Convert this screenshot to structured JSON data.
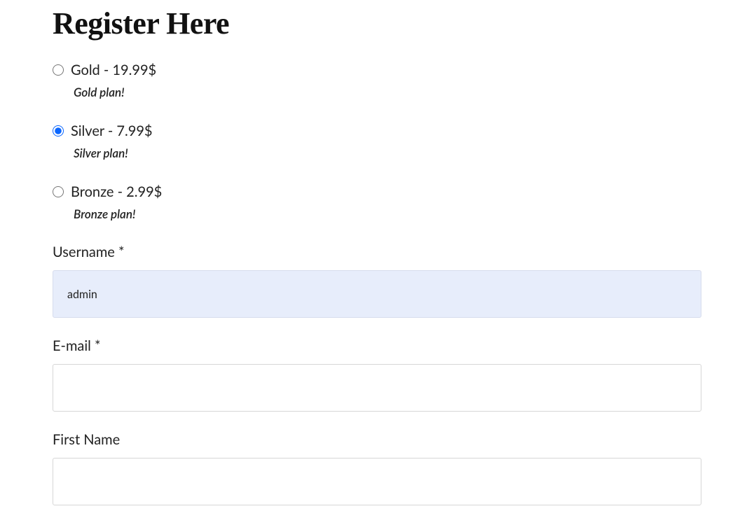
{
  "page": {
    "title": "Register Here"
  },
  "plans": {
    "gold": {
      "label": "Gold - 19.99$",
      "desc": "Gold plan!",
      "checked": false
    },
    "silver": {
      "label": "Silver - 7.99$",
      "desc": "Silver plan!",
      "checked": true
    },
    "bronze": {
      "label": "Bronze - 2.99$",
      "desc": "Bronze plan!",
      "checked": false
    }
  },
  "fields": {
    "username": {
      "label": "Username *",
      "value": "admin"
    },
    "email": {
      "label": "E-mail *",
      "value": ""
    },
    "firstname": {
      "label": "First Name",
      "value": ""
    }
  }
}
